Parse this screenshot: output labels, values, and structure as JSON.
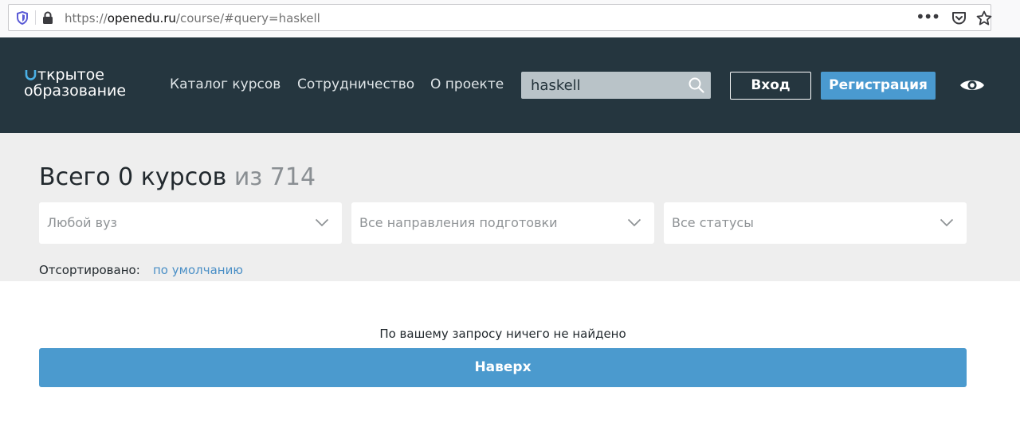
{
  "browser": {
    "url_prefix": "https://",
    "url_domain": "openedu.ru",
    "url_path": "/course/#query=haskell",
    "menu_dots": "•••"
  },
  "header": {
    "logo_line1_first": "О",
    "logo_line1_rest": "ткрытое",
    "logo_line2": "образование",
    "nav": [
      "Каталог курсов",
      "Сотрудничество",
      "О проекте"
    ],
    "search_value": "haskell",
    "login_label": "Вход",
    "register_label": "Регистрация",
    "colors": {
      "header_bg": "#25363f",
      "accent": "#4a9ad0"
    }
  },
  "filters": {
    "title_main": "Всего 0 курсов",
    "title_total": "из 714",
    "selects": [
      "Любой вуз",
      "Все направления подготовки",
      "Все статусы"
    ],
    "sort_label": "Отсортировано:",
    "sort_value": "по умолчанию"
  },
  "results": {
    "empty_message": "По вашему запросу ничего не найдено",
    "top_button": "Наверх"
  }
}
